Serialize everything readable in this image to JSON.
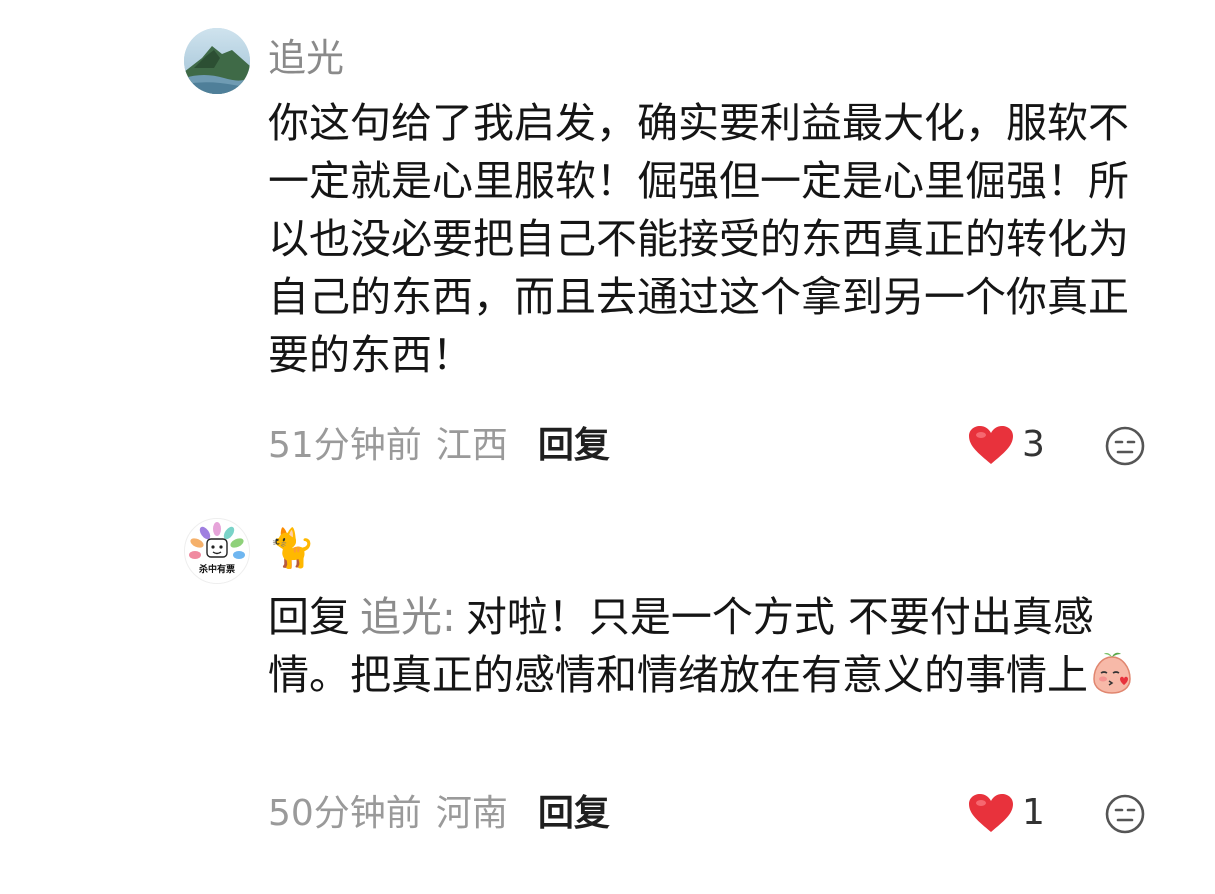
{
  "comments": [
    {
      "avatar": "mountain-lake-avatar",
      "username": "追光",
      "text": "你这句给了我启发，确实要利益最大化，服软不一定就是心里服软！倔强但一定是心里倔强！所以也没必要把自己不能接受的东西真正的转化为自己的东西，而且去通过这个拿到另一个你真正要的东西！",
      "time": "51分钟前",
      "location": "江西",
      "reply_label": "回复",
      "likes": "3"
    },
    {
      "avatar": "colorful-badge-avatar",
      "avatar_text": "杀中有票",
      "username": "🐈",
      "reply_prefix": "回复",
      "reply_target": "追光:",
      "text": "对啦！只是一个方式 不要付出真感情。把真正的感情和情绪放在有意义的事情上",
      "emoji": "blushing-face-emoji",
      "time": "50分钟前",
      "location": "河南",
      "reply_label": "回复",
      "likes": "1"
    }
  ],
  "colors": {
    "like_red": "#e8323c",
    "muted_text": "#9a9a9a",
    "username_gray": "#8a8a8a"
  }
}
